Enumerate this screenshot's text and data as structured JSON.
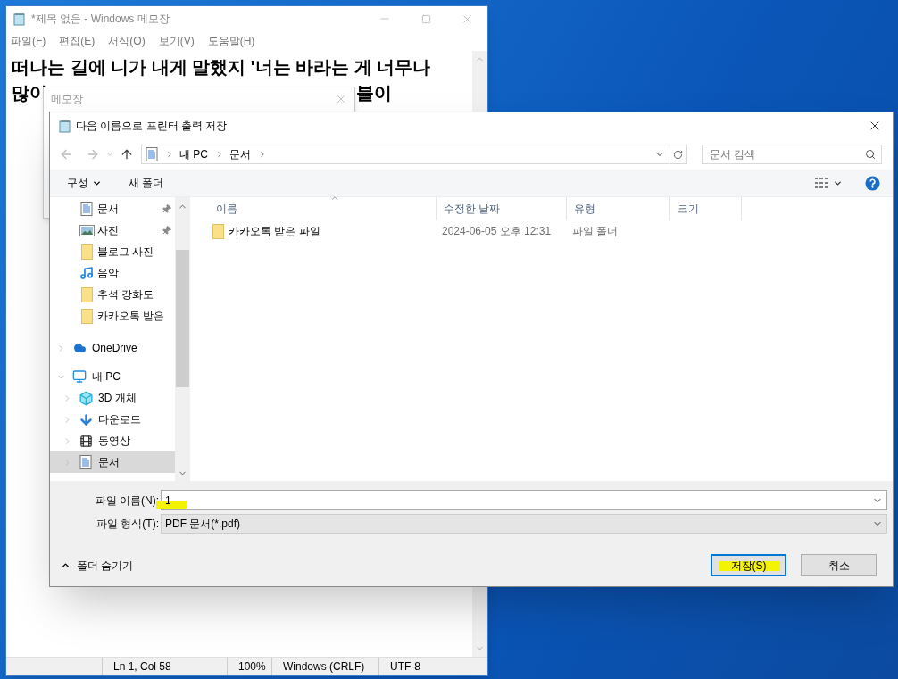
{
  "notepad": {
    "title": "*제목 없음 - Windows 메모장",
    "menu": [
      "파일(F)",
      "편집(E)",
      "서식(O)",
      "보기(V)",
      "도움말(H)"
    ],
    "text_line": "떠나는 길에 니가 내게 말했지 '너는 바라는 게 너무나",
    "text_fragments": [
      "많이",
      "불이"
    ],
    "status_bar": [
      "Ln 1, Col 58",
      "100%",
      "Windows (CRLF)",
      "UTF-8"
    ]
  },
  "message_box": {
    "title": "메모장"
  },
  "dialog": {
    "title": "다음 이름으로 프린터 출력 저장",
    "breadcrumb": [
      "내 PC",
      "문서"
    ],
    "search": {
      "placeholder": "문서 검색"
    },
    "toolbar": [
      "구성",
      "새 폴더"
    ],
    "quick_access": [
      {
        "label": "문서",
        "kind": "document",
        "pinned": true
      },
      {
        "label": "사진",
        "kind": "pictures",
        "pinned": true
      },
      {
        "label": "블로그 사진",
        "kind": "folder",
        "pinned": false
      },
      {
        "label": "음악",
        "kind": "music",
        "pinned": false
      },
      {
        "label": "추석 강화도",
        "kind": "folder",
        "pinned": false
      },
      {
        "label": "카카오톡 받은",
        "kind": "folder",
        "pinned": false
      }
    ],
    "tree": [
      {
        "label": "OneDrive",
        "kind": "cloud",
        "expanded": false,
        "selected": false
      },
      {
        "label": "내 PC",
        "kind": "computer",
        "expanded": true,
        "selected": false,
        "children": [
          {
            "label": "3D 개체",
            "kind": "cube",
            "expanded": false,
            "selected": false
          },
          {
            "label": "다운로드",
            "kind": "download",
            "expanded": false,
            "selected": false
          },
          {
            "label": "동영상",
            "kind": "film",
            "expanded": false,
            "selected": false
          },
          {
            "label": "문서",
            "kind": "document",
            "expanded": false,
            "selected": true
          }
        ]
      }
    ],
    "columns": [
      "이름",
      "수정한 날짜",
      "유형",
      "크기"
    ],
    "rows": [
      {
        "name": "카카오톡 받은 파일",
        "modified": "2024-06-05 오후 12:31",
        "type": "파일 폴더"
      }
    ],
    "filename": {
      "label": "파일 이름(N):",
      "value": "1",
      "highlighted": true
    },
    "filetype": {
      "label": "파일 형식(T):",
      "value": "PDF 문서(*.pdf)"
    },
    "hide_folders": "폴더 숨기기",
    "buttons": [
      {
        "label": "저장(S)",
        "default": true,
        "highlighted": true
      },
      {
        "label": "취소",
        "default": false,
        "highlighted": false
      }
    ]
  }
}
